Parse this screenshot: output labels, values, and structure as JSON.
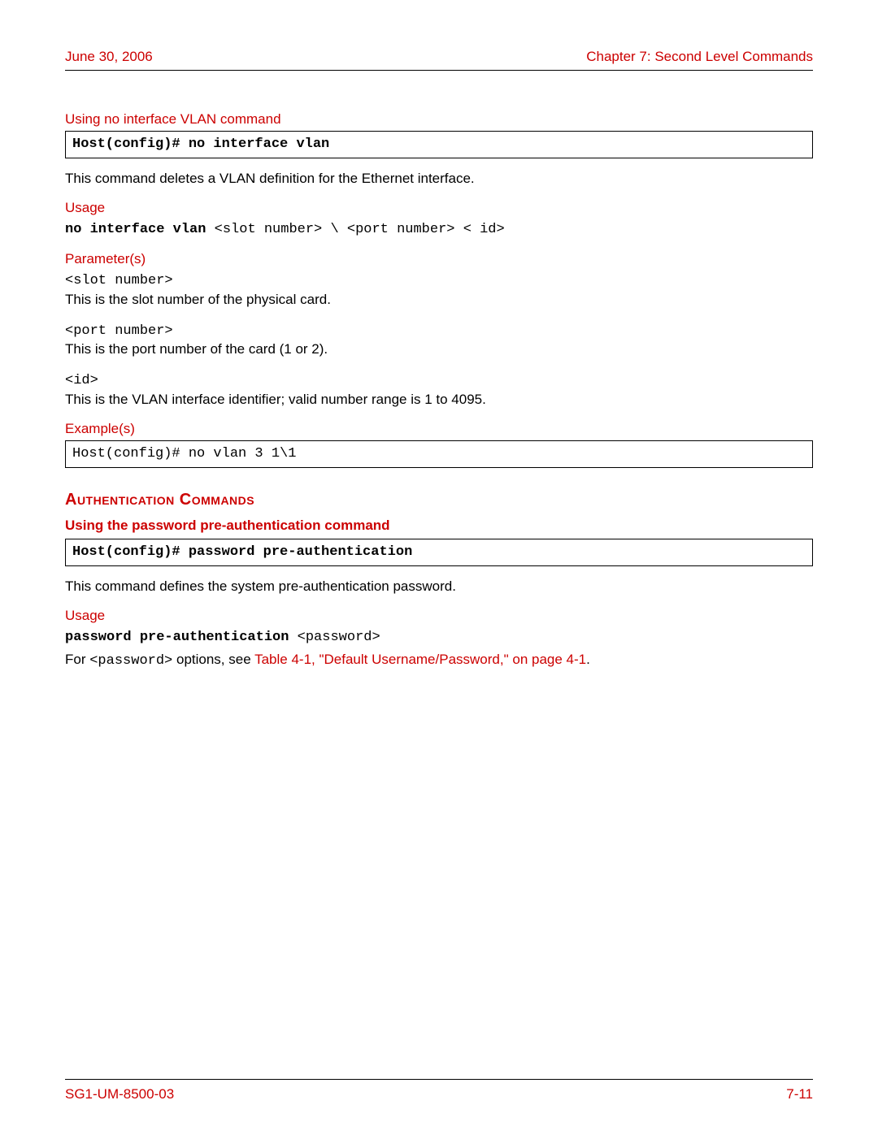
{
  "header": {
    "date": "June 30, 2006",
    "chapter": "Chapter 7: Second Level Commands"
  },
  "sec1": {
    "title": "Using no interface VLAN command",
    "codebox": "Host(config)# no interface vlan",
    "desc": "This command deletes a VLAN definition for the Ethernet interface.",
    "usage_label": "Usage",
    "usage_cmd_bold": "no interface  vlan",
    "usage_cmd_rest": " <slot number> \\ <port number> < id>",
    "params_label": "Parameter(s)",
    "p1_code": "<slot number>",
    "p1_desc": "This is the slot number of the physical card.",
    "p2_code": "<port number>",
    "p2_desc": "This is the port number of the card (1 or 2).",
    "p3_code": "<id>",
    "p3_desc": "This is the VLAN interface identifier; valid number range is 1 to 4095.",
    "examples_label": "Example(s)",
    "example_code": "Host(config)#  no vlan 3 1\\1"
  },
  "sec2": {
    "big_title": "Authentication Commands",
    "subtitle": "Using the password pre-authentication command",
    "codebox": "Host(config)# password pre-authentication",
    "desc": "This command defines the system pre-authentication password.",
    "usage_label": "Usage",
    "usage_cmd_bold": "password pre-authentication",
    "usage_cmd_rest": " <password>",
    "ref_prefix": "For ",
    "ref_code": "<password>",
    "ref_mid": " options, see ",
    "ref_link": "Table 4-1, \"Default Username/Password,\" on page 4-1",
    "ref_suffix": "."
  },
  "footer": {
    "doc_id": "SG1-UM-8500-03",
    "page_num": "7-11"
  }
}
